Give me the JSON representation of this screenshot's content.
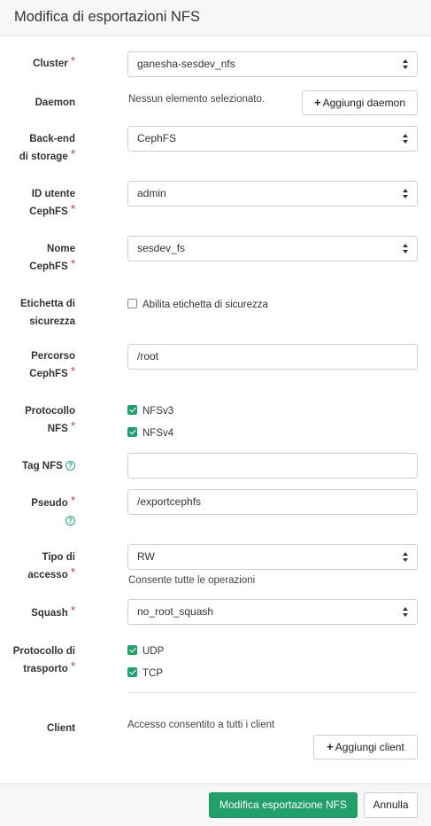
{
  "title": "Modifica di esportazioni NFS",
  "required_mark": "*",
  "help_glyph": "?",
  "fields": {
    "cluster": {
      "label": "Cluster",
      "value": "ganesha-sesdev_nfs"
    },
    "daemon": {
      "label": "Daemon",
      "empty_text": "Nessun elemento selezionato.",
      "add_label": "Aggiungi daemon"
    },
    "storage_backend": {
      "label_line1": "Back-end",
      "label_line2": "di storage",
      "value": "CephFS"
    },
    "cephfs_user": {
      "label_line1": "ID utente",
      "label_line2": "CephFS",
      "value": "admin"
    },
    "cephfs_name": {
      "label_line1": "Nome",
      "label_line2": "CephFS",
      "value": "sesdev_fs"
    },
    "security_label": {
      "label_line1": "Etichetta di",
      "label_line2": "sicurezza",
      "checkbox_label": "Abilita etichetta di sicurezza",
      "checked": false
    },
    "cephfs_path": {
      "label_line1": "Percorso",
      "label_line2": "CephFS",
      "value": "/root"
    },
    "nfs_protocol": {
      "label_line1": "Protocollo",
      "label_line2": "NFS",
      "options": [
        {
          "label": "NFSv3",
          "checked": true
        },
        {
          "label": "NFSv4",
          "checked": true
        }
      ]
    },
    "nfs_tag": {
      "label": "Tag NFS",
      "value": ""
    },
    "pseudo": {
      "label": "Pseudo",
      "value": "/exportcephfs"
    },
    "access_type": {
      "label_line1": "Tipo di",
      "label_line2": "accesso",
      "value": "RW",
      "hint": "Consente tutte le operazioni"
    },
    "squash": {
      "label": "Squash",
      "value": "no_root_squash"
    },
    "transport": {
      "label_line1": "Protocollo di",
      "label_line2": "trasporto",
      "options": [
        {
          "label": "UDP",
          "checked": true
        },
        {
          "label": "TCP",
          "checked": true
        }
      ]
    },
    "clients": {
      "label": "Client",
      "empty_text": "Accesso consentito a tutti i client",
      "add_label": "Aggiungi client"
    }
  },
  "footer": {
    "submit_label": "Modifica esportazione NFS",
    "cancel_label": "Annulla"
  },
  "colors": {
    "accent": "#22a06b",
    "required": "#c23a3a"
  },
  "icons": {
    "plus": "plus-icon",
    "help": "help-circle-icon",
    "select_arrows": "sort-arrows-icon",
    "check": "checkmark-icon"
  }
}
